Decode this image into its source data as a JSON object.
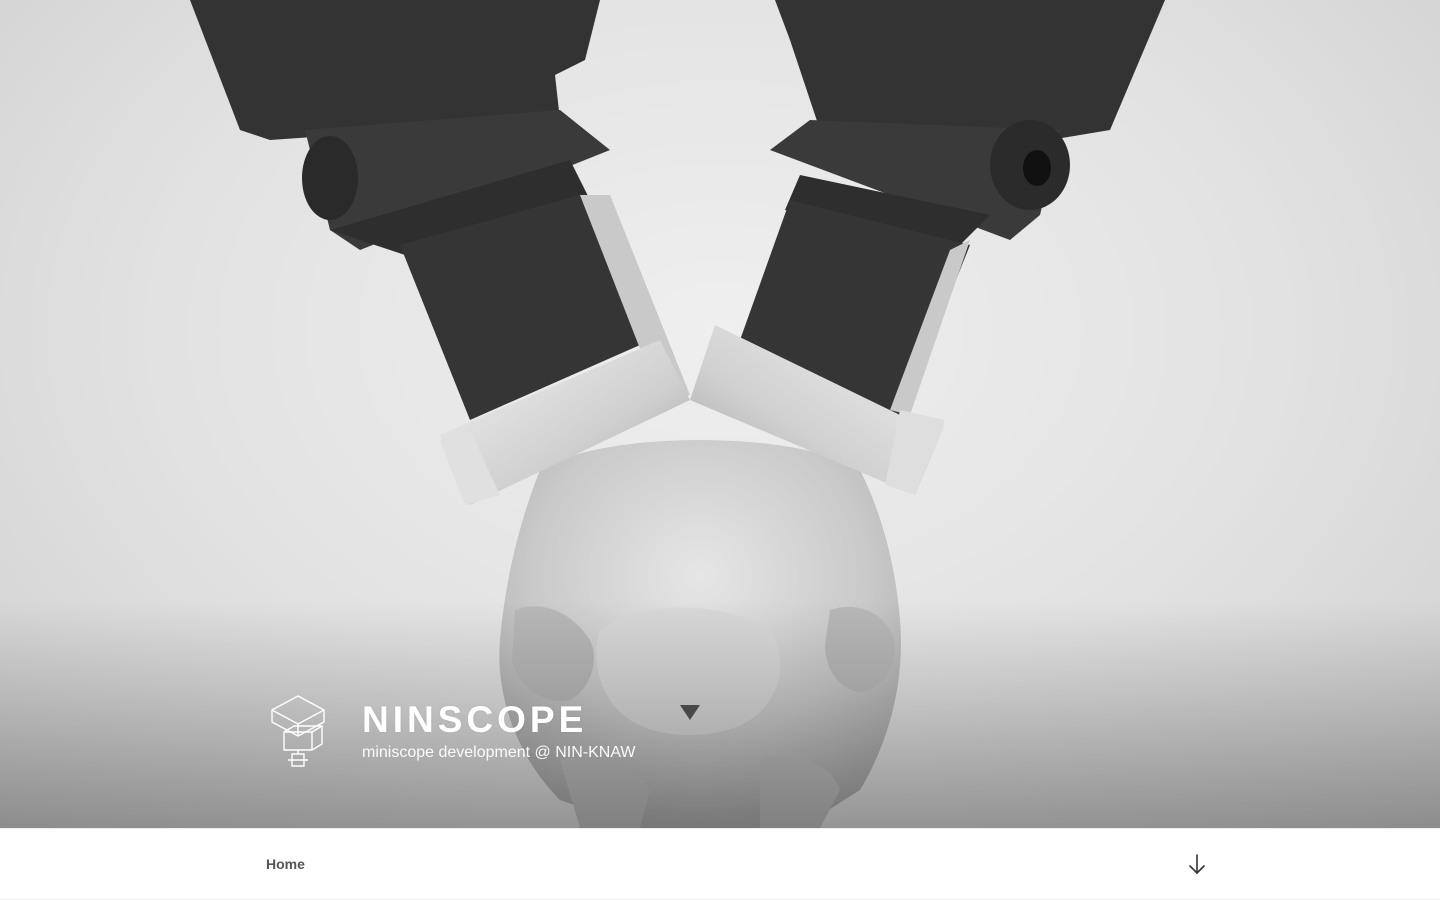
{
  "site": {
    "title": "NINSCOPE",
    "description": "miniscope development @ NIN-KNAW"
  },
  "nav": {
    "items": [
      {
        "label": "Home"
      }
    ],
    "scroll_icon": "arrow-down-icon"
  },
  "hero": {
    "image_subject": "two-miniscope-arms-over-mouse-skull"
  },
  "colors": {
    "accent": "#222222",
    "nav_text": "#555555",
    "title_text": "#ffffff"
  }
}
